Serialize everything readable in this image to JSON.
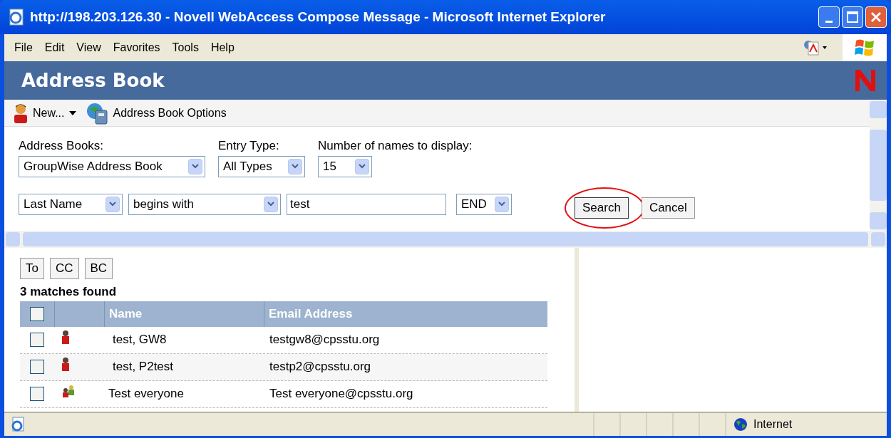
{
  "window": {
    "title": "http://198.203.126.30 - Novell WebAccess Compose Message - Microsoft Internet Explorer"
  },
  "menu": [
    "File",
    "Edit",
    "View",
    "Favorites",
    "Tools",
    "Help"
  ],
  "header": {
    "title": "Address Book"
  },
  "toolbar": [
    {
      "kind": "new",
      "label": "New..."
    },
    {
      "kind": "options",
      "label": "Address Book Options"
    }
  ],
  "filters": [
    {
      "label": "Address Books:",
      "value": "GroupWise Address Book"
    },
    {
      "label": "Entry Type:",
      "value": "All Types"
    },
    {
      "label": "Number of names to display:",
      "value": "15"
    }
  ],
  "search": {
    "field": "Last Name",
    "operator": "begins with",
    "value": "test",
    "end": "END"
  },
  "actions": [
    {
      "label": "Search",
      "circled": true
    },
    {
      "label": "Cancel",
      "circled": false
    }
  ],
  "recipient_buttons": [
    "To",
    "CC",
    "BC"
  ],
  "matches": "3 matches found",
  "table": {
    "columns": [
      "Name",
      "Email Address"
    ],
    "all_checked": false,
    "rows": [
      {
        "kind": "person",
        "name": "test, GW8",
        "email": "testgw8@cpsstu.org",
        "checked": false
      },
      {
        "kind": "person",
        "name": "test, P2test",
        "email": "testp2@cpsstu.org",
        "checked": false
      },
      {
        "kind": "group",
        "name": "Test everyone",
        "email": "Test everyone@cpsstu.org",
        "checked": false
      }
    ]
  },
  "status_bar": {
    "zone": "Internet"
  }
}
